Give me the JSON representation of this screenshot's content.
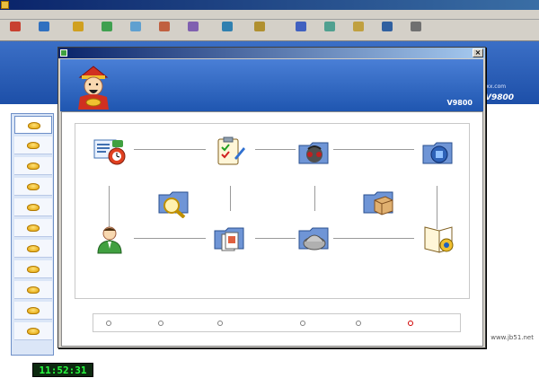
{
  "app": {
    "title": "",
    "menus": [
      "",
      "",
      "",
      "",
      "",
      "",
      "",
      "",
      "",
      ""
    ],
    "toolbar": [
      {
        "label": "",
        "icon": "supplier-icon",
        "color": "#c84030"
      },
      {
        "label": "",
        "icon": "customer-icon",
        "color": "#3070c0"
      },
      {
        "label": "",
        "icon": "transfer-icon",
        "color": "#d0a020"
      },
      {
        "label": "",
        "icon": "purchase-icon",
        "color": "#40a050"
      },
      {
        "label": "",
        "icon": "purchase-return-icon",
        "color": "#60a0d0"
      },
      {
        "label": "",
        "icon": "outbound-icon",
        "color": "#c06040"
      },
      {
        "label": "",
        "icon": "stock-query-icon",
        "color": "#8060b0"
      },
      {
        "label": "",
        "icon": "sales-manage-icon",
        "color": "#3080b0"
      },
      {
        "label": "",
        "icon": "finance-manage-icon",
        "color": "#b09030"
      },
      {
        "label": "",
        "icon": "user-upgrade-icon",
        "color": "#4060c0"
      },
      {
        "label": "",
        "icon": "daily-report-icon",
        "color": "#50a090"
      },
      {
        "label": "",
        "icon": "password-icon",
        "color": "#c0a040"
      },
      {
        "label": "",
        "icon": "guide-icon",
        "color": "#3060a0"
      },
      {
        "label": "",
        "icon": "log-icon",
        "color": "#707070"
      }
    ],
    "background_version": "V9800",
    "background_site": "www.lxxx.com",
    "clock": "11:52:31"
  },
  "dialog": {
    "title": "",
    "close_label": "×",
    "brand_title": "",
    "brand_subtitle": "",
    "edition_label": "",
    "version": "V9800",
    "section_legend": "",
    "nodes": [
      {
        "id": "sales-order",
        "label": "",
        "icon": "sales-order-icon"
      },
      {
        "id": "sales-return",
        "label": "",
        "icon": "sales-return-icon"
      },
      {
        "id": "receivable",
        "label": "",
        "icon": "receivable-icon"
      },
      {
        "id": "cash-receipt",
        "label": "",
        "icon": "cash-receipt-icon"
      },
      {
        "id": "stock-detail",
        "label": "",
        "icon": "stock-detail-icon"
      },
      {
        "id": "daily-income",
        "label": "",
        "icon": "daily-income-icon"
      },
      {
        "id": "purchase-in",
        "label": "",
        "icon": "purchase-in-icon"
      },
      {
        "id": "purchase-return",
        "label": "",
        "icon": "purchase-return-node-icon"
      },
      {
        "id": "payable",
        "label": "",
        "icon": "payable-icon"
      },
      {
        "id": "cash-payment",
        "label": "",
        "icon": "cash-payment-icon"
      }
    ],
    "links": [
      {
        "label": "",
        "highlight": false
      },
      {
        "label": "",
        "highlight": false
      },
      {
        "label": "",
        "highlight": false
      },
      {
        "label": "",
        "highlight": false
      },
      {
        "label": "",
        "highlight": false
      },
      {
        "label": "",
        "highlight": true
      }
    ]
  },
  "watermark": {
    "main": "",
    "url": "www.jb51.net"
  }
}
